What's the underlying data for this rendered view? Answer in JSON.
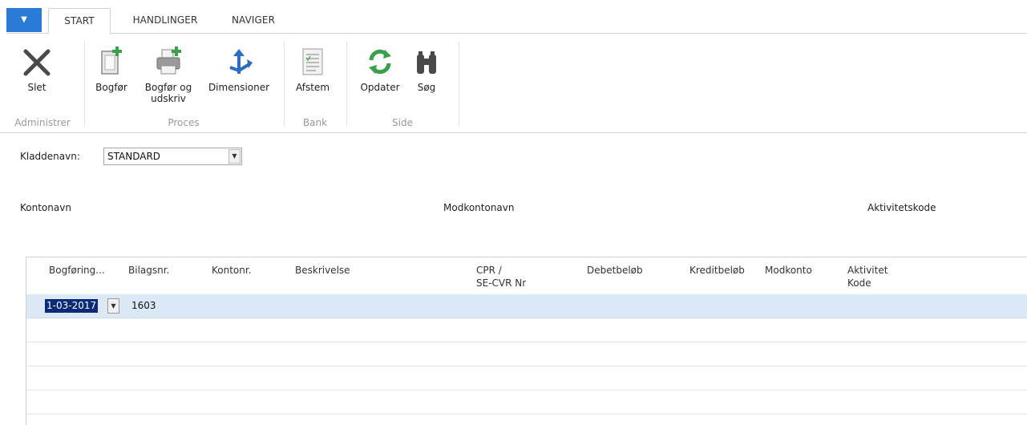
{
  "tabs": {
    "menu_arrow": "▼",
    "start": "START",
    "handlinger": "HANDLINGER",
    "naviger": "NAVIGER"
  },
  "ribbon": {
    "slet": "Slet",
    "bogfor": "Bogfør",
    "bogfor_udskriv_1": "Bogfør og",
    "bogfor_udskriv_2": "udskriv",
    "dimensioner": "Dimensioner",
    "afstem": "Afstem",
    "opdater": "Opdater",
    "sog": "Søg",
    "groups": {
      "administrer": "Administrer",
      "proces": "Proces",
      "bank": "Bank",
      "side": "Side"
    },
    "icons": {
      "slet": "delete-x-icon",
      "bogfor": "post-document-icon",
      "bogfor_udskriv": "post-print-icon",
      "dimensioner": "dimensions-icon",
      "afstem": "reconcile-icon",
      "opdater": "refresh-icon",
      "sog": "binoculars-icon"
    }
  },
  "filter": {
    "label": "Kladdenavn:",
    "value": "STANDARD"
  },
  "info": {
    "kontonavn": "Kontonavn",
    "modkontonavn": "Modkontonavn",
    "aktivitetskode": "Aktivitetskode"
  },
  "grid": {
    "headers": {
      "bogforing": "Bogføring...",
      "bilagsnr": "Bilagsnr.",
      "kontonr": "Kontonr.",
      "beskrivelse": "Beskrivelse",
      "cpr_1": "CPR /",
      "cpr_2": "SE-CVR Nr",
      "debet": "Debetbeløb",
      "kredit": "Kreditbeløb",
      "modkonto": "Modkonto",
      "aktivitet_1": "Aktivitet",
      "aktivitet_2": "Kode"
    },
    "rows": [
      {
        "date": "1-03-2017",
        "bilagsnr": "1603"
      }
    ]
  },
  "colors": {
    "accent": "#2a7bd6",
    "selected_row": "#dbe9f7",
    "refresh_green": "#3aa04a",
    "dimensions_blue": "#2b6cc4"
  }
}
